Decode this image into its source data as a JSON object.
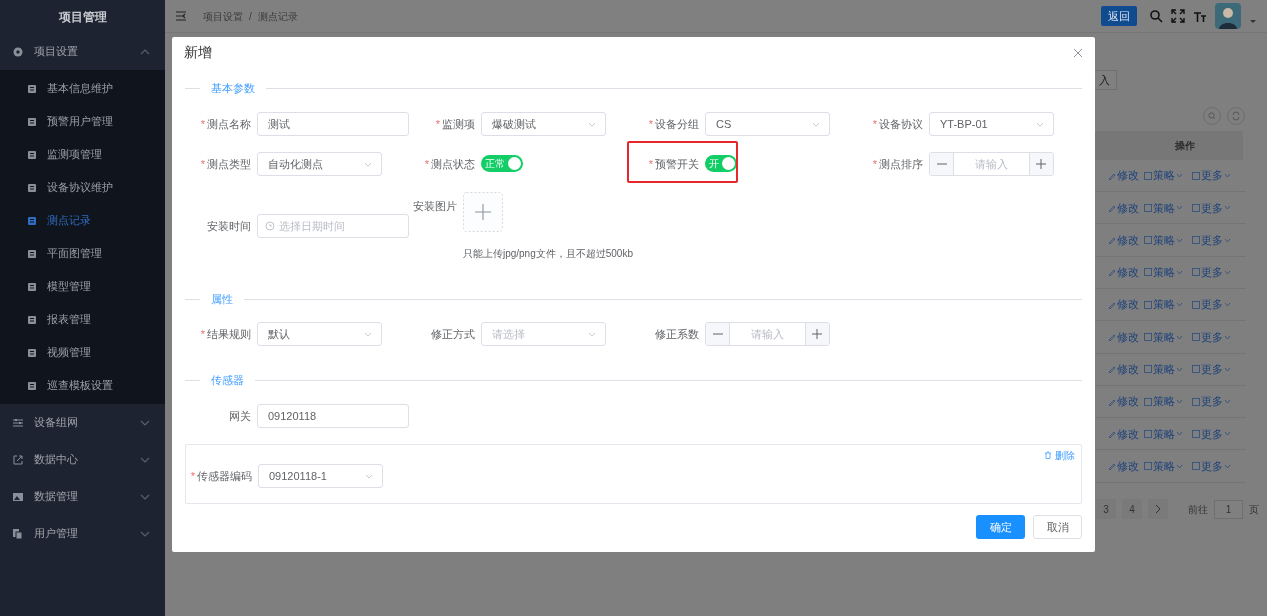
{
  "sidebar": {
    "title": "项目管理",
    "groups": [
      {
        "label": "项目设置",
        "expanded": true,
        "children": [
          {
            "label": "基本信息维护",
            "selected": false
          },
          {
            "label": "预警用户管理",
            "selected": false
          },
          {
            "label": "监测项管理",
            "selected": false
          },
          {
            "label": "设备协议维护",
            "selected": false
          },
          {
            "label": "测点记录",
            "selected": true
          },
          {
            "label": "平面图管理",
            "selected": false
          },
          {
            "label": "模型管理",
            "selected": false
          },
          {
            "label": "报表管理",
            "selected": false
          },
          {
            "label": "视频管理",
            "selected": false
          },
          {
            "label": "巡查模板设置",
            "selected": false
          }
        ]
      },
      {
        "label": "设备组网",
        "expanded": false
      },
      {
        "label": "数据中心",
        "expanded": false
      },
      {
        "label": "数据管理",
        "expanded": false
      },
      {
        "label": "用户管理",
        "expanded": false
      }
    ]
  },
  "header": {
    "breadcrumb": [
      "项目设置",
      "测点记录"
    ],
    "separator": "/",
    "back_button": "返回"
  },
  "table": {
    "search_fragment": "入",
    "columns": [
      "操作"
    ],
    "rows": [
      {
        "actions": [
          "修改",
          "策略",
          "更多"
        ]
      },
      {
        "actions": [
          "修改",
          "策略",
          "更多"
        ]
      },
      {
        "actions": [
          "修改",
          "策略",
          "更多"
        ]
      },
      {
        "actions": [
          "修改",
          "策略",
          "更多"
        ]
      },
      {
        "actions": [
          "修改",
          "策略",
          "更多"
        ]
      },
      {
        "actions": [
          "修改",
          "策略",
          "更多"
        ]
      },
      {
        "actions": [
          "修改",
          "策略",
          "更多"
        ]
      },
      {
        "actions": [
          "修改",
          "策略",
          "更多"
        ]
      },
      {
        "actions": [
          "修改",
          "策略",
          "更多"
        ]
      },
      {
        "actions": [
          "修改",
          "策略",
          "更多"
        ]
      }
    ]
  },
  "pagination": {
    "pages": [
      "3",
      "4"
    ],
    "goto_label": "前往",
    "goto_value": "1",
    "page_suffix": "页"
  },
  "dialog": {
    "title": "新增",
    "sections": [
      {
        "title": "基本参数",
        "fields": [
          {
            "kind": "input",
            "required_mark": "*",
            "label": "测点名称",
            "value": "测试"
          },
          {
            "kind": "select",
            "required_mark": "*",
            "label": "监测项",
            "value": "爆破测试"
          },
          {
            "kind": "select",
            "required_mark": "*",
            "label": "设备分组",
            "value": "CS"
          },
          {
            "kind": "select",
            "required_mark": "*",
            "label": "设备协议",
            "value": "YT-BP-01"
          },
          {
            "kind": "select",
            "required_mark": "*",
            "label": "测点类型",
            "value": "自动化测点"
          },
          {
            "kind": "switch",
            "required_mark": "*",
            "label": "测点状态",
            "on": true,
            "text": "正常"
          },
          {
            "kind": "switch",
            "required_mark": "*",
            "label": "预警开关",
            "on": true,
            "text": "开",
            "highlighted": true
          },
          {
            "kind": "number",
            "required_mark": "*",
            "label": "测点排序",
            "placeholder": "请输入"
          },
          {
            "kind": "date",
            "label": "安装时间",
            "placeholder": "选择日期时间"
          },
          {
            "kind": "upload",
            "label": "安装图片",
            "hint": "只能上传jpg/png文件，且不超过500kb"
          }
        ]
      },
      {
        "title": "属性",
        "fields": [
          {
            "kind": "select",
            "required_mark": "*",
            "label": "结果规则",
            "value": "默认"
          },
          {
            "kind": "select",
            "label": "修正方式",
            "placeholder": "请选择"
          },
          {
            "kind": "number",
            "label": "修正系数",
            "placeholder": "请输入"
          }
        ]
      },
      {
        "title": "传感器",
        "fields": [
          {
            "kind": "input",
            "label": "网关",
            "value": "09120118"
          }
        ],
        "sensors": [
          {
            "delete": "删除",
            "fields": [
              {
                "kind": "select",
                "required_mark": "*",
                "label": "传感器编码",
                "value": "09120118-1"
              }
            ]
          }
        ]
      }
    ],
    "buttons": [
      {
        "label": "确定",
        "primary": true
      },
      {
        "label": "取消",
        "primary": false
      }
    ]
  }
}
